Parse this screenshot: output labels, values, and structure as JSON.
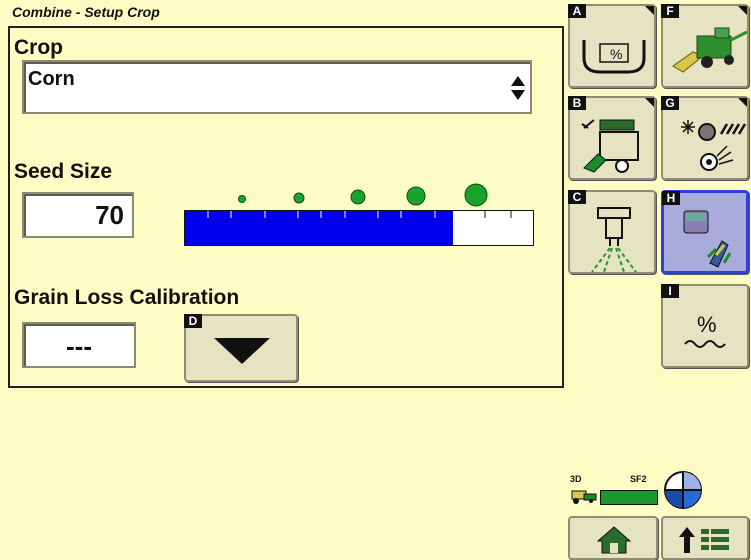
{
  "header": {
    "title": "Combine - Setup Crop"
  },
  "crop": {
    "label": "Crop",
    "value": "Corn"
  },
  "seed_size": {
    "label": "Seed Size",
    "value": "70",
    "level_percent": 77
  },
  "grain_loss": {
    "label": "Grain Loss Calibration",
    "value": "---",
    "dropdown_letter": "D"
  },
  "softkeys": {
    "a": {
      "letter": "A",
      "icon": "tank-percent-icon"
    },
    "b": {
      "letter": "B",
      "icon": "unloading-auger-icon"
    },
    "c": {
      "letter": "C",
      "icon": "sprayer-icon"
    },
    "f": {
      "letter": "F",
      "icon": "combine-icon"
    },
    "g": {
      "letter": "G",
      "icon": "threshing-settings-icon"
    },
    "h": {
      "letter": "H",
      "icon": "crop-setup-icon",
      "selected": true
    },
    "i": {
      "letter": "I",
      "icon": "moisture-percent-icon"
    }
  },
  "status": {
    "mode_3d": "3D",
    "sf": "SF2",
    "signal_color": "#1a9a2a"
  },
  "colors": {
    "background": "#fcfcc4",
    "bar_fill": "#0000ee",
    "selected": "#a9acda"
  }
}
